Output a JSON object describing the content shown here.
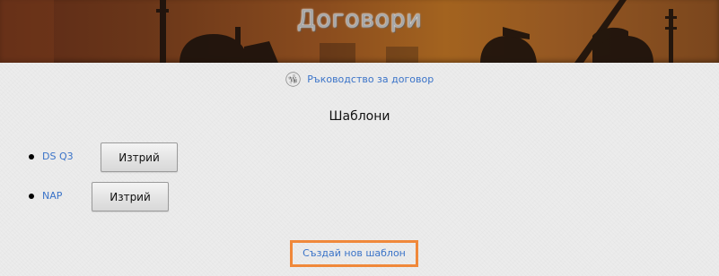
{
  "header": {
    "title": "Договори"
  },
  "guide": {
    "icon": "wikipedia-globe-icon",
    "label": "Ръководство за договор"
  },
  "templates": {
    "heading": "Шаблони",
    "items": [
      {
        "name": "DS Q3",
        "delete_label": "Изтрий"
      },
      {
        "name": "NAP",
        "delete_label": "Изтрий"
      }
    ]
  },
  "create": {
    "label": "Създай нов шаблон",
    "highlight_color": "#f0883a"
  },
  "colors": {
    "link": "#3a73c8",
    "page_background": "#ececec",
    "header_background": "#8a4c1e"
  }
}
